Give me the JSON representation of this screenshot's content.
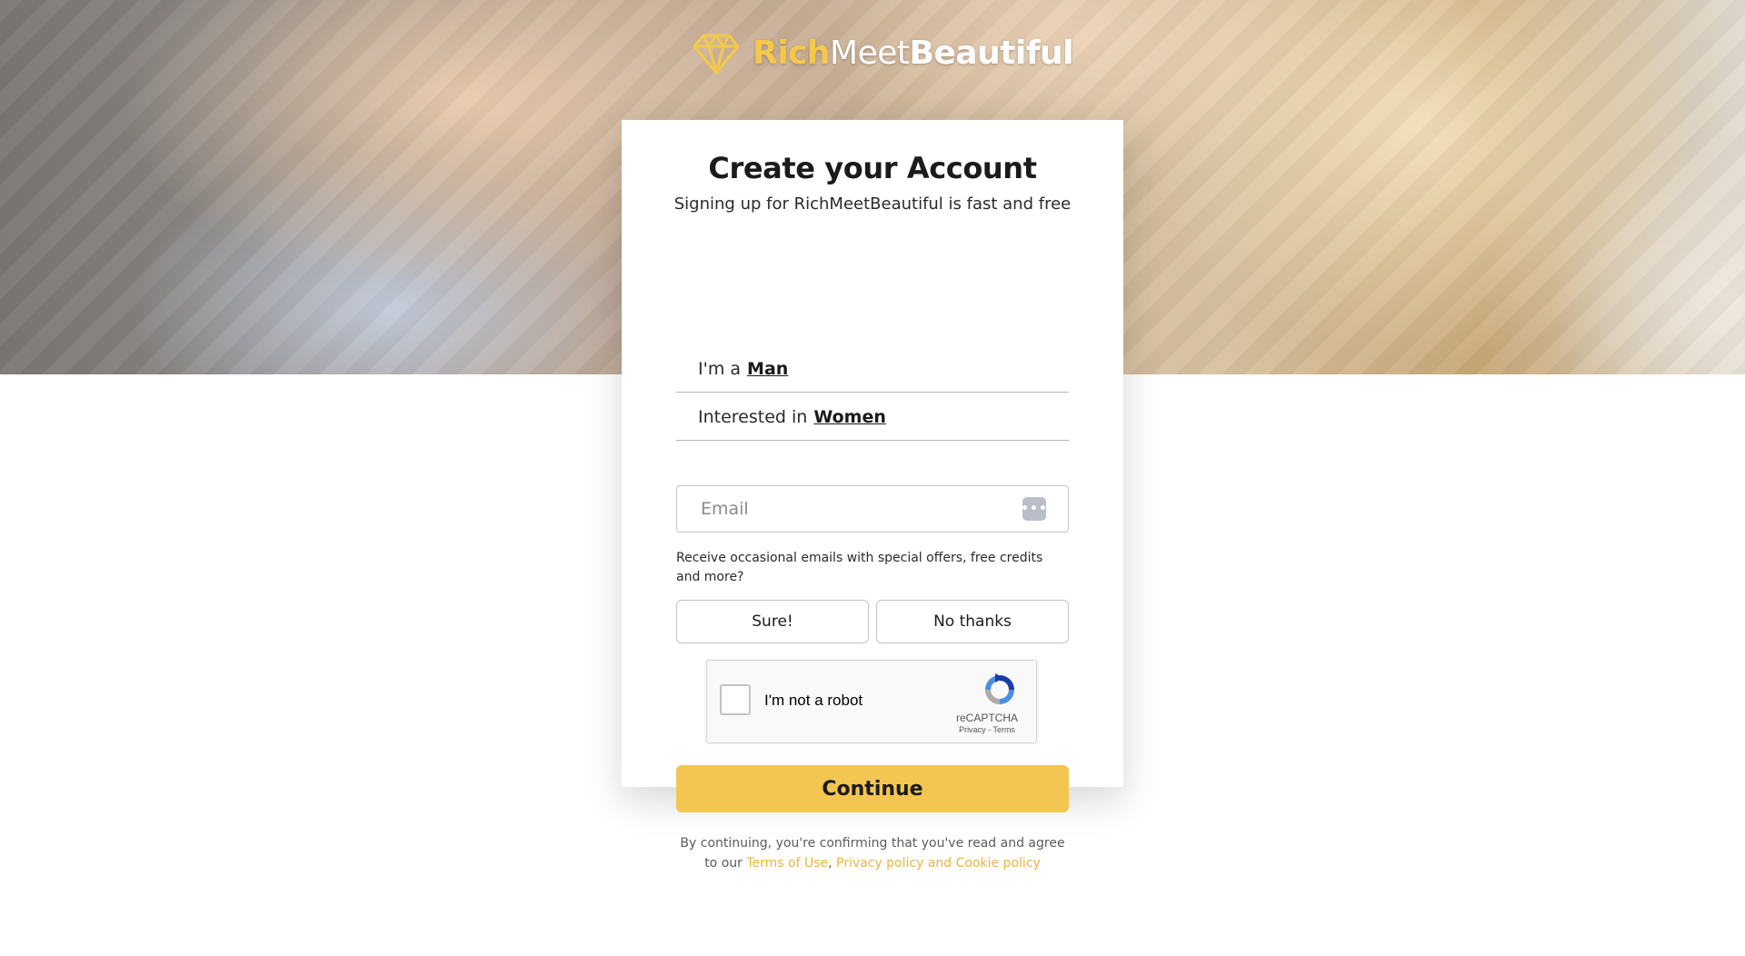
{
  "brand": {
    "rich": "Rich",
    "meet": "Meet",
    "beautiful": "Beautiful",
    "accent_color": "#f5c84c"
  },
  "signup": {
    "title": "Create your Account",
    "subtitle": "Signing up for RichMeetBeautiful is fast and free",
    "gender_prefix": "I'm a",
    "gender_value": "Man",
    "interest_prefix": "Interested in",
    "interest_value": "Women",
    "email_placeholder": "Email",
    "password_manager_icon": "ellipsis-key-icon",
    "offers_text": "Receive occasional emails with special offers, free credits and more?",
    "sure_label": "Sure!",
    "no_thanks_label": "No thanks",
    "continue_label": "Continue",
    "continue_color": "#f3c651",
    "legal_prefix": "By continuing, you're confirming that you've read and agree to our",
    "terms_link": "Terms of Use",
    "separator": ",",
    "privacy_link": "Privacy policy and Cookie policy"
  },
  "recaptcha": {
    "label": "I'm not a robot",
    "brand": "reCAPTCHA",
    "privacy": "Privacy",
    "dash": "-",
    "terms": "Terms"
  }
}
